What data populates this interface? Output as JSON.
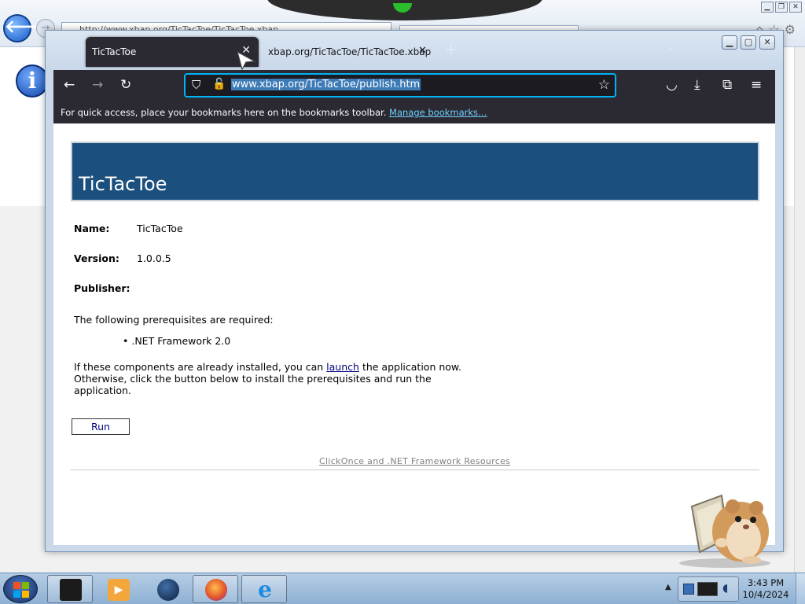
{
  "ie": {
    "address_text": "http://www.xbap.org/TicTacToe/TicTacToe.xbap",
    "back_glyph": "🡐",
    "info_glyph": "i"
  },
  "firefox": {
    "tabs": [
      {
        "label": "TicTacToe",
        "close": "✕"
      },
      {
        "label": "xbap.org/TicTacToe/TicTacToe.xbap",
        "close": "✕"
      }
    ],
    "new_tab": "+",
    "tab_list": "⌄",
    "window_buttons": {
      "minimize": "▁",
      "maximize": "▢",
      "close": "✕"
    },
    "nav": {
      "back": "←",
      "forward": "→",
      "reload": "↻"
    },
    "url": "www.xbap.org/TicTacToe/publish.htm",
    "url_icons": {
      "shield": "⛉",
      "lock": "🔓",
      "star": "☆"
    },
    "toolbar_icons": {
      "pocket": "◡",
      "download": "⤓",
      "extensions": "⧉",
      "menu": "≡"
    },
    "bookmarks_bar": {
      "text": "For quick access, place your bookmarks here on the bookmarks toolbar.",
      "link": "Manage bookmarks…"
    }
  },
  "page": {
    "title": "TicTacToe",
    "fields": [
      {
        "label": "Name:",
        "value": "TicTacToe"
      },
      {
        "label": "Version:",
        "value": "1.0.0.5"
      },
      {
        "label": "Publisher:",
        "value": ""
      }
    ],
    "prereq_heading": "The following prerequisites are required:",
    "prereq_item": ".NET Framework 2.0",
    "install_text_before": "If these components are already installed, you can",
    "install_link": "launch",
    "install_text_after_1": "the application now.",
    "install_text_line2": "Otherwise, click the button below to install the prerequisites and run the",
    "install_text_line3": "application.",
    "run_button": "Run",
    "resources_link": "ClickOnce and .NET Framework Resources"
  },
  "taskbar": {
    "time": "3:43 PM",
    "date": "10/4/2024",
    "apps": [
      "terminal-app",
      "media-player-app",
      "globe-app",
      "firefox-app",
      "internet-explorer-app"
    ]
  },
  "colors": {
    "banner": "#1b4f7e",
    "ff_chrome": "#2b2a33",
    "url_focus": "#00b3f4",
    "link": "#000080"
  }
}
